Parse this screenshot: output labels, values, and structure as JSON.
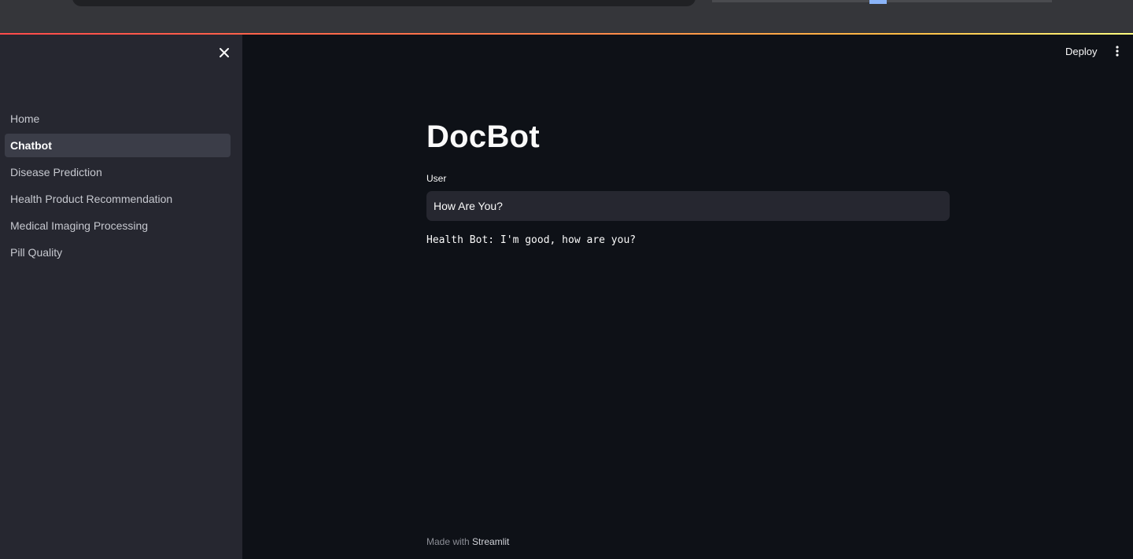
{
  "sidebar": {
    "close_icon": "close-icon",
    "items": [
      {
        "label": "Home",
        "active": false
      },
      {
        "label": "Chatbot",
        "active": true
      },
      {
        "label": "Disease Prediction",
        "active": false
      },
      {
        "label": "Health Product Recommendation",
        "active": false
      },
      {
        "label": "Medical Imaging Processing",
        "active": false
      },
      {
        "label": "Pill Quality",
        "active": false
      }
    ]
  },
  "header": {
    "deploy_label": "Deploy",
    "menu_icon": "more-vertical-icon"
  },
  "main": {
    "title": "DocBot",
    "input_label": "User",
    "input_value": "How Are You?",
    "response": "Health Bot: I'm good, how are you?"
  },
  "footer": {
    "prefix": "Made with ",
    "brand": "Streamlit"
  },
  "colors": {
    "background": "#0e1117",
    "sidebar": "#262730",
    "accent": "#ff4b4b"
  }
}
